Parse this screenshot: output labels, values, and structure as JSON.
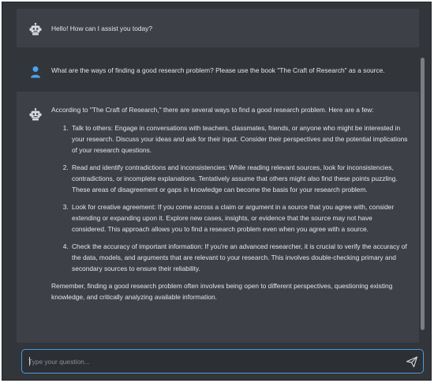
{
  "chat": {
    "messages": [
      {
        "role": "assistant",
        "text": "Hello! How can I assist you today?"
      },
      {
        "role": "user",
        "text": "What are the ways of finding a good research problem? Please use the book \"The Craft of Research\" as a source."
      },
      {
        "role": "assistant",
        "intro": "According to \"The Craft of Research,\" there are several ways to find a good research problem. Here are a few:",
        "points": [
          "Talk to others: Engage in conversations with teachers, classmates, friends, or anyone who might be interested in your research. Discuss your ideas and ask for their input. Consider their perspectives and the potential implications of your research questions.",
          "Read and identify contradictions and inconsistencies: While reading relevant sources, look for inconsistencies, contradictions, or incomplete explanations. Tentatively assume that others might also find these points puzzling. These areas of disagreement or gaps in knowledge can become the basis for your research problem.",
          "Look for creative agreement: If you come across a claim or argument in a source that you agree with, consider extending or expanding upon it. Explore new cases, insights, or evidence that the source may not have considered. This approach allows you to find a research problem even when you agree with a source.",
          "Check the accuracy of important information: If you're an advanced researcher, it is crucial to verify the accuracy of the data, models, and arguments that are relevant to your research. This involves double-checking primary and secondary sources to ensure their reliability."
        ],
        "outro": "Remember, finding a good research problem often involves being open to different perspectives, questioning existing knowledge, and critically analyzing available information."
      }
    ]
  },
  "composer": {
    "placeholder": "Type your question...",
    "send_icon": "send-icon"
  },
  "icons": {
    "assistant_avatar": "robot-icon",
    "user_avatar": "user-icon"
  },
  "colors": {
    "background": "#32353a",
    "assistant_bubble": "#3d4046",
    "accent": "#4a9be0",
    "user_icon": "#4aa3f0",
    "text": "#e4e6ea"
  }
}
